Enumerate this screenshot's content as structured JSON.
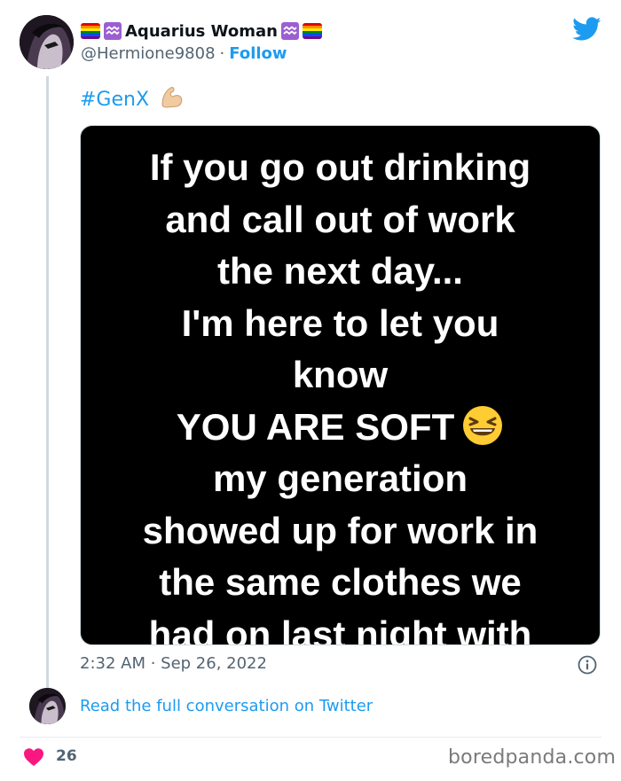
{
  "tweet": {
    "display_name": "Aquarius Woman",
    "handle": "@Hermione9808",
    "separator": "·",
    "follow_label": "Follow",
    "hashtag": "#GenX",
    "image_text_lines": [
      "If you go out drinking",
      "and call out of work",
      "the next day...",
      "I'm here to let you",
      "know",
      "YOU ARE SOFT",
      "my generation",
      "showed up for work in",
      "the same clothes we",
      "had on last night with"
    ],
    "timestamp": "2:32 AM · Sep 26, 2022",
    "read_conversation_label": "Read the full conversation on Twitter",
    "like_count": "26"
  },
  "icons": {
    "brand": "twitter-bird-icon",
    "name_decorations": [
      "rainbow-flag-icon",
      "aquarius-icon"
    ],
    "hashtag_emoji": "flexed-biceps-icon",
    "image_emoji": "laughing-face-icon",
    "info": "info-icon",
    "like": "heart-icon"
  },
  "colors": {
    "link_blue": "#1d9bf0",
    "muted_gray": "#536471",
    "like_pink": "#f91880",
    "image_background": "#000000"
  },
  "watermark": "boredpanda.com"
}
